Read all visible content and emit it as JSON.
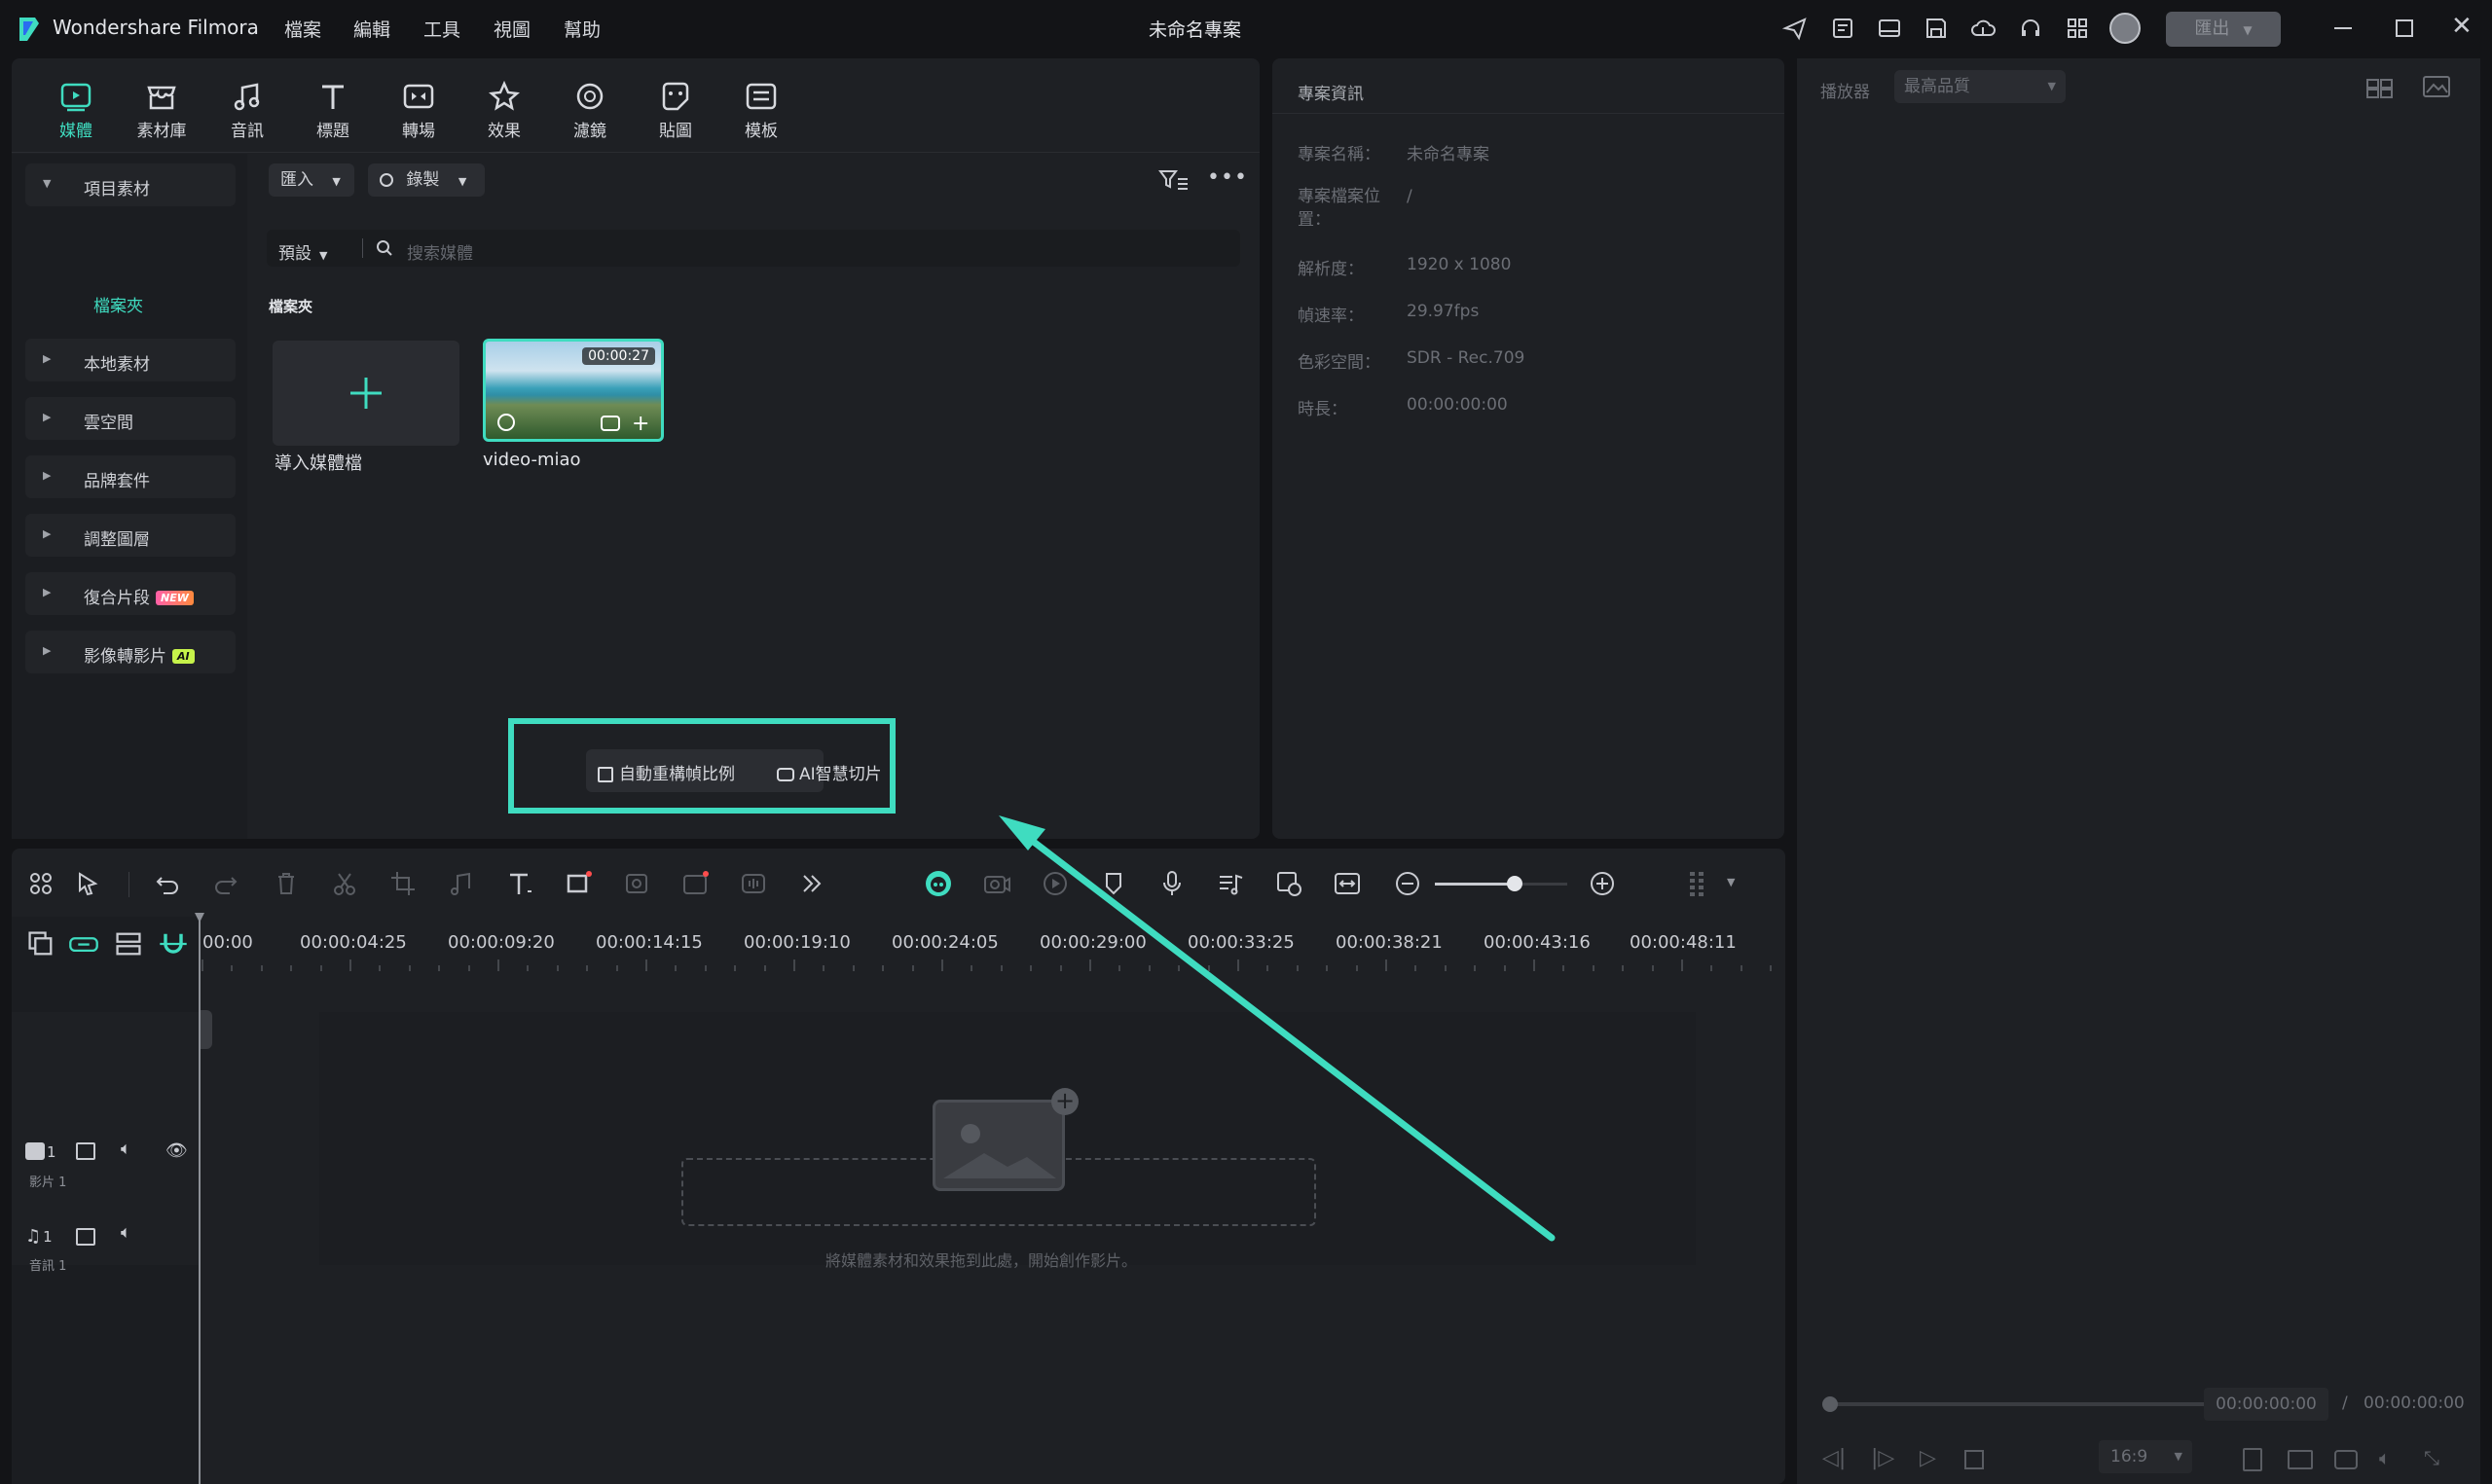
{
  "titlebar": {
    "app_name": "Wondershare Filmora",
    "menu": [
      "檔案",
      "編輯",
      "工具",
      "視圖",
      "幫助"
    ],
    "project_name": "未命名專案",
    "export_label": "匯出"
  },
  "media_tabs": [
    {
      "label": "媒體",
      "icon": "media-icon",
      "active": true
    },
    {
      "label": "素材庫",
      "icon": "stock-icon",
      "active": false
    },
    {
      "label": "音訊",
      "icon": "audio-icon",
      "active": false
    },
    {
      "label": "標題",
      "icon": "title-icon",
      "active": false
    },
    {
      "label": "轉場",
      "icon": "transition-icon",
      "active": false
    },
    {
      "label": "效果",
      "icon": "effects-icon",
      "active": false
    },
    {
      "label": "濾鏡",
      "icon": "filter-icon",
      "active": false
    },
    {
      "label": "貼圖",
      "icon": "sticker-icon",
      "active": false
    },
    {
      "label": "模板",
      "icon": "template-icon",
      "active": false
    }
  ],
  "sidebar": {
    "project_media": "項目素材",
    "folder": "檔案夾",
    "items": [
      {
        "label": "本地素材"
      },
      {
        "label": "雲空間"
      },
      {
        "label": "品牌套件"
      },
      {
        "label": "調整圖層"
      },
      {
        "label": "復合片段",
        "badge": "NEW"
      },
      {
        "label": "影像轉影片",
        "badge": "AI"
      }
    ]
  },
  "media_toolbar": {
    "import_label": "匯入",
    "record_label": "錄製",
    "sort_label": "預設",
    "search_placeholder": "搜索媒體",
    "folder_title": "檔案夾"
  },
  "media_items": [
    {
      "label": "導入媒體檔"
    },
    {
      "label": "video-miao",
      "duration": "00:00:27"
    }
  ],
  "floating_actions": {
    "auto_reframe": "自動重構幀比例",
    "ai_smart_cut": "AI智慧切片"
  },
  "project_info": {
    "header": "專案資訊",
    "rows": [
      {
        "label": "專案名稱：",
        "value": "未命名專案"
      },
      {
        "label": "專案檔案位置：",
        "value": "/"
      },
      {
        "label": "解析度：",
        "value": "1920 x 1080"
      },
      {
        "label": "幀速率：",
        "value": "29.97fps"
      },
      {
        "label": "色彩空間：",
        "value": "SDR - Rec.709"
      },
      {
        "label": "時長：",
        "value": "00:00:00:00"
      }
    ]
  },
  "player": {
    "label": "播放器",
    "quality": "最高品質",
    "current_time": "00:00:00:00",
    "separator": "/",
    "total_time": "00:00:00:00",
    "aspect": "16:9"
  },
  "timeline": {
    "ticks": [
      "00:00",
      "00:00:04:25",
      "00:00:09:20",
      "00:00:14:15",
      "00:00:19:10",
      "00:00:24:05",
      "00:00:29:00",
      "00:00:33:25",
      "00:00:38:21",
      "00:00:43:16",
      "00:00:48:11"
    ],
    "video_track": {
      "number": "1",
      "name": "影片 1"
    },
    "audio_track": {
      "number": "1",
      "name": "音訊 1"
    },
    "drop_hint": "將媒體素材和效果拖到此處，開始創作影片。",
    "zoom_level": 0.6
  },
  "colors": {
    "accent": "#3fdcc0",
    "background": "#131417",
    "panel": "#1e2024"
  }
}
